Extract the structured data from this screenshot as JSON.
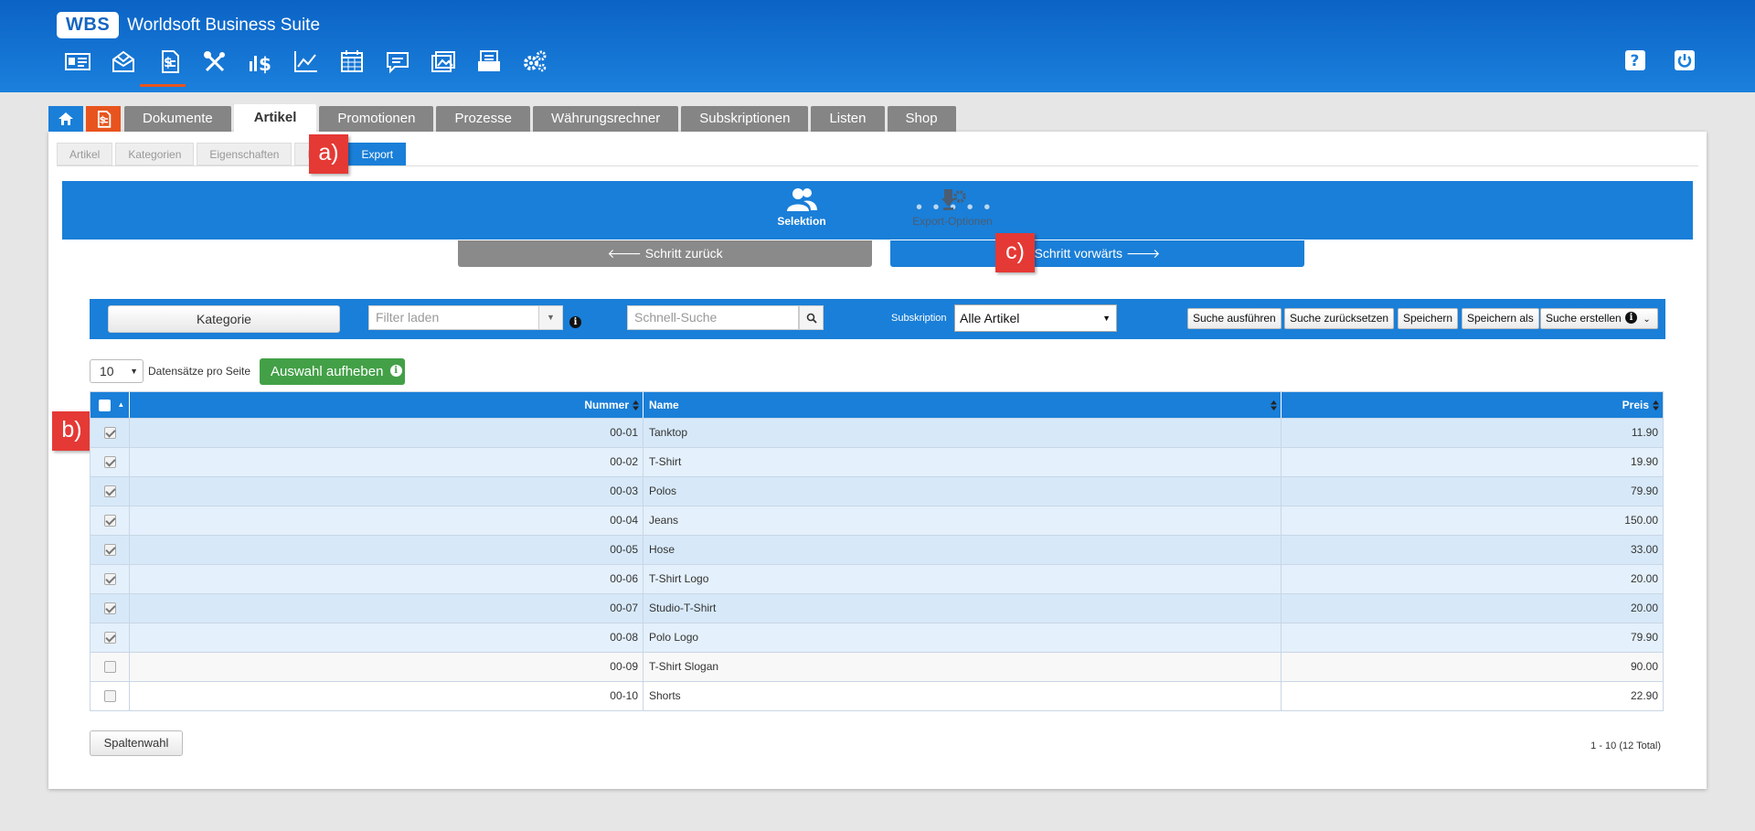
{
  "header": {
    "logo_box": "WBS",
    "logo_text": "Worldsoft Business Suite",
    "icons": [
      "contact-card-icon",
      "mail-icon",
      "document-dollar-icon",
      "tools-icon",
      "finance-icon",
      "chart-icon",
      "calendar-icon",
      "chat-icon",
      "gallery-icon",
      "newsletter-icon",
      "settings-icon"
    ],
    "right_icons": [
      "help-icon",
      "power-icon"
    ]
  },
  "tabs": {
    "items": [
      "Dokumente",
      "Artikel",
      "Promotionen",
      "Prozesse",
      "Währungsrechner",
      "Subskriptionen",
      "Listen",
      "Shop"
    ],
    "active": "Artikel"
  },
  "subtabs": {
    "items": [
      "Artikel",
      "Kategorien",
      "Eigenschaften",
      "Im",
      "Export"
    ],
    "active": "Export"
  },
  "steps": {
    "step1": "Selektion",
    "step2": "Export-Optionen",
    "dots": "• • • • •"
  },
  "nav": {
    "back": "🡐 Schritt zurück",
    "forward": "Schritt vorwärts 🡒"
  },
  "callouts": {
    "a": "a)",
    "b": "b)",
    "c": "c)"
  },
  "filter": {
    "kategorie": "Kategorie",
    "filter_placeholder": "Filter laden",
    "search_placeholder": "Schnell-Suche",
    "subskription_label": "Subskription",
    "subskription_value": "Alle Artikel",
    "buttons": [
      "Suche ausführen",
      "Suche zurücksetzen",
      "Speichern",
      "Speichern als",
      "Suche erstellen"
    ]
  },
  "pagesize": {
    "value": "10",
    "label": "Datensätze pro Seite",
    "auswahl_button": "Auswahl aufheben"
  },
  "table": {
    "headers": {
      "number": "Nummer",
      "name": "Name",
      "price": "Preis"
    },
    "rows": [
      {
        "checked": true,
        "number": "00-01",
        "name": "Tanktop",
        "price": "11.90"
      },
      {
        "checked": true,
        "number": "00-02",
        "name": "T-Shirt",
        "price": "19.90"
      },
      {
        "checked": true,
        "number": "00-03",
        "name": "Polos",
        "price": "79.90"
      },
      {
        "checked": true,
        "number": "00-04",
        "name": "Jeans",
        "price": "150.00"
      },
      {
        "checked": true,
        "number": "00-05",
        "name": "Hose",
        "price": "33.00"
      },
      {
        "checked": true,
        "number": "00-06",
        "name": "T-Shirt Logo",
        "price": "20.00"
      },
      {
        "checked": true,
        "number": "00-07",
        "name": "Studio-T-Shirt",
        "price": "20.00"
      },
      {
        "checked": true,
        "number": "00-08",
        "name": "Polo Logo",
        "price": "79.90"
      },
      {
        "checked": false,
        "number": "00-09",
        "name": "T-Shirt Slogan",
        "price": "90.00"
      },
      {
        "checked": false,
        "number": "00-10",
        "name": "Shorts",
        "price": "22.90"
      }
    ]
  },
  "footer": {
    "spaltenwahl": "Spaltenwahl",
    "total": "1 - 10 (12 Total)"
  },
  "colors": {
    "header_blue": "#1a7fd8",
    "accent_orange": "#e8541e",
    "callout_red": "#e53935",
    "green": "#43a047"
  }
}
